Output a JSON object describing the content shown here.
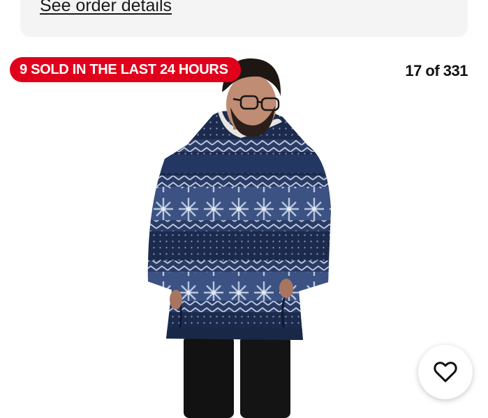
{
  "order": {
    "link_label": "See order details"
  },
  "listing": {
    "sold_badge": "9 SOLD IN THE LAST 24 HOURS",
    "image_counter": "17 of 331"
  },
  "icons": {
    "favorite": "heart-outline-icon"
  },
  "colors": {
    "badge_background": "#e0001b",
    "badge_text": "#ffffff",
    "card_background": "#f4f4f4",
    "hoodie_navy": "#1d2c50"
  }
}
